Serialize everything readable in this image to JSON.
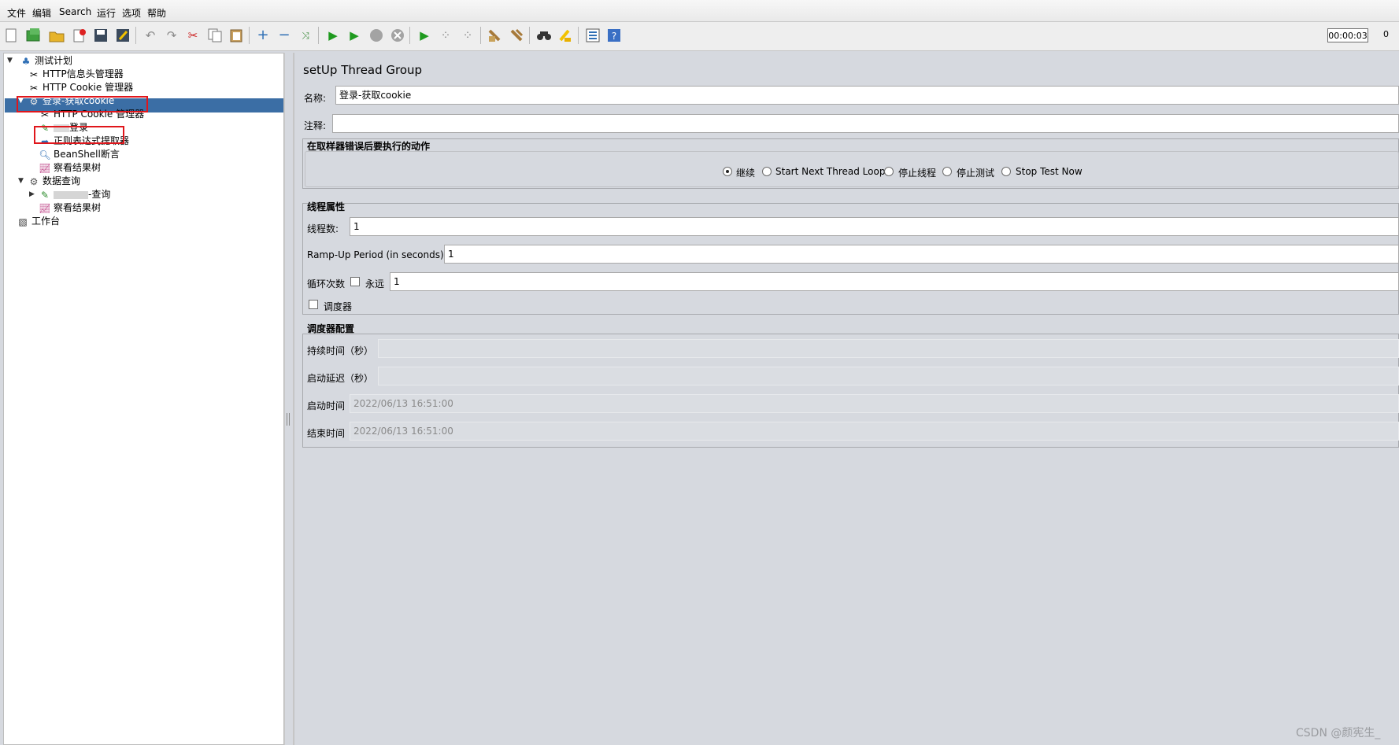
{
  "menu": [
    "文件",
    "编辑",
    "Search",
    "运行",
    "选项",
    "帮助"
  ],
  "toolbar": {
    "icons": [
      "new-icon",
      "templates-icon",
      "open-icon",
      "close-icon",
      "save-icon",
      "save-as-icon",
      "undo-icon",
      "redo-icon",
      "cut-icon",
      "copy-icon",
      "paste-icon",
      "expand-icon",
      "collapse-icon",
      "toggle-icon",
      "start-icon",
      "start-no-pause-icon",
      "stop-icon",
      "shutdown-icon",
      "remote-start-icon",
      "remote-stop-icon",
      "remote-shutdown-icon",
      "clear-icon",
      "clear-all-icon",
      "search-icon",
      "reset-search-icon",
      "function-helper-icon",
      "help-icon"
    ],
    "timer": "00:00:03",
    "active_threads": "0"
  },
  "tree": {
    "items": [
      {
        "label": "测试计划",
        "icon": "flask-icon"
      },
      {
        "label": "HTTP信息头管理器",
        "icon": "tools-icon"
      },
      {
        "label": "HTTP Cookie 管理器",
        "icon": "tools-icon"
      },
      {
        "label": "登录-获取cookie",
        "icon": "gear-icon"
      },
      {
        "label": "HTTP Cookie 管理器",
        "icon": "tools-icon"
      },
      {
        "label": "登录",
        "icon": "pipette-icon"
      },
      {
        "label": "正则表达式提取器",
        "icon": "arrow-icon"
      },
      {
        "label": "BeanShell断言",
        "icon": "magnifier-icon"
      },
      {
        "label": "察看结果树",
        "icon": "chart-icon"
      },
      {
        "label": "数据查询",
        "icon": "gear-icon"
      },
      {
        "label": "-查询",
        "icon": "pipette-icon"
      },
      {
        "label": "察看结果树",
        "icon": "chart-icon"
      },
      {
        "label": "工作台",
        "icon": "workbench-icon"
      }
    ]
  },
  "panel": {
    "title": "setUp Thread Group",
    "name_label": "名称:",
    "name_value": "登录-获取cookie",
    "comment_label": "注释:",
    "comment_value": "",
    "error_group_title": "在取样器错误后要执行的动作",
    "error_options": [
      "继续",
      "Start Next Thread Loop",
      "停止线程",
      "停止测试",
      "Stop Test Now"
    ],
    "selected_option": "继续",
    "thread_group_title": "线程属性",
    "threads_label": "线程数:",
    "threads_value": "1",
    "rampup_label": "Ramp-Up Period (in seconds):",
    "rampup_value": "1",
    "loop_label": "循环次数",
    "forever_label": "永远",
    "loop_value": "1",
    "scheduler_label": "调度器",
    "scheduler_config_title": "调度器配置",
    "duration_label": "持续时间（秒）",
    "duration_value": "",
    "delay_label": "启动延迟（秒）",
    "delay_value": "",
    "start_label": "启动时间",
    "start_value": "2022/06/13 16:51:00",
    "end_label": "结束时间",
    "end_value": "2022/06/13 16:51:00"
  },
  "watermark": "CSDN @颜宪生_"
}
